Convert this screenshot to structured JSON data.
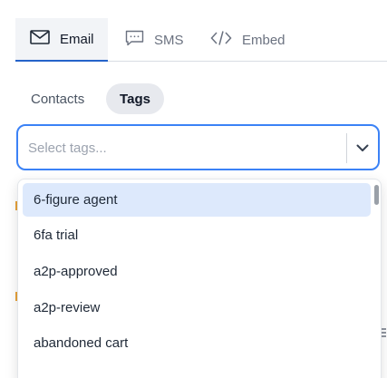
{
  "tabs": [
    {
      "label": "Email",
      "icon": "mail-icon",
      "active": true
    },
    {
      "label": "SMS",
      "icon": "chat-bubble-icon",
      "active": false
    },
    {
      "label": "Embed",
      "icon": "code-icon",
      "active": false
    }
  ],
  "segment": {
    "contacts_label": "Contacts",
    "tags_label": "Tags",
    "active": "Tags"
  },
  "tag_select": {
    "placeholder": "Select tags...",
    "value": "",
    "chevron_icon": "chevron-down-icon"
  },
  "dropdown": {
    "highlighted_index": 0,
    "options": [
      "6-figure agent",
      "6fa trial",
      "a2p-approved",
      "a2p-review",
      "abandoned cart"
    ]
  },
  "colors": {
    "accent": "#2563c9",
    "focus_border": "#3b82f6",
    "highlight": "#dde9fc",
    "active_tab_bg": "#f2f4f7",
    "active_pill_bg": "#e7e9ee"
  }
}
